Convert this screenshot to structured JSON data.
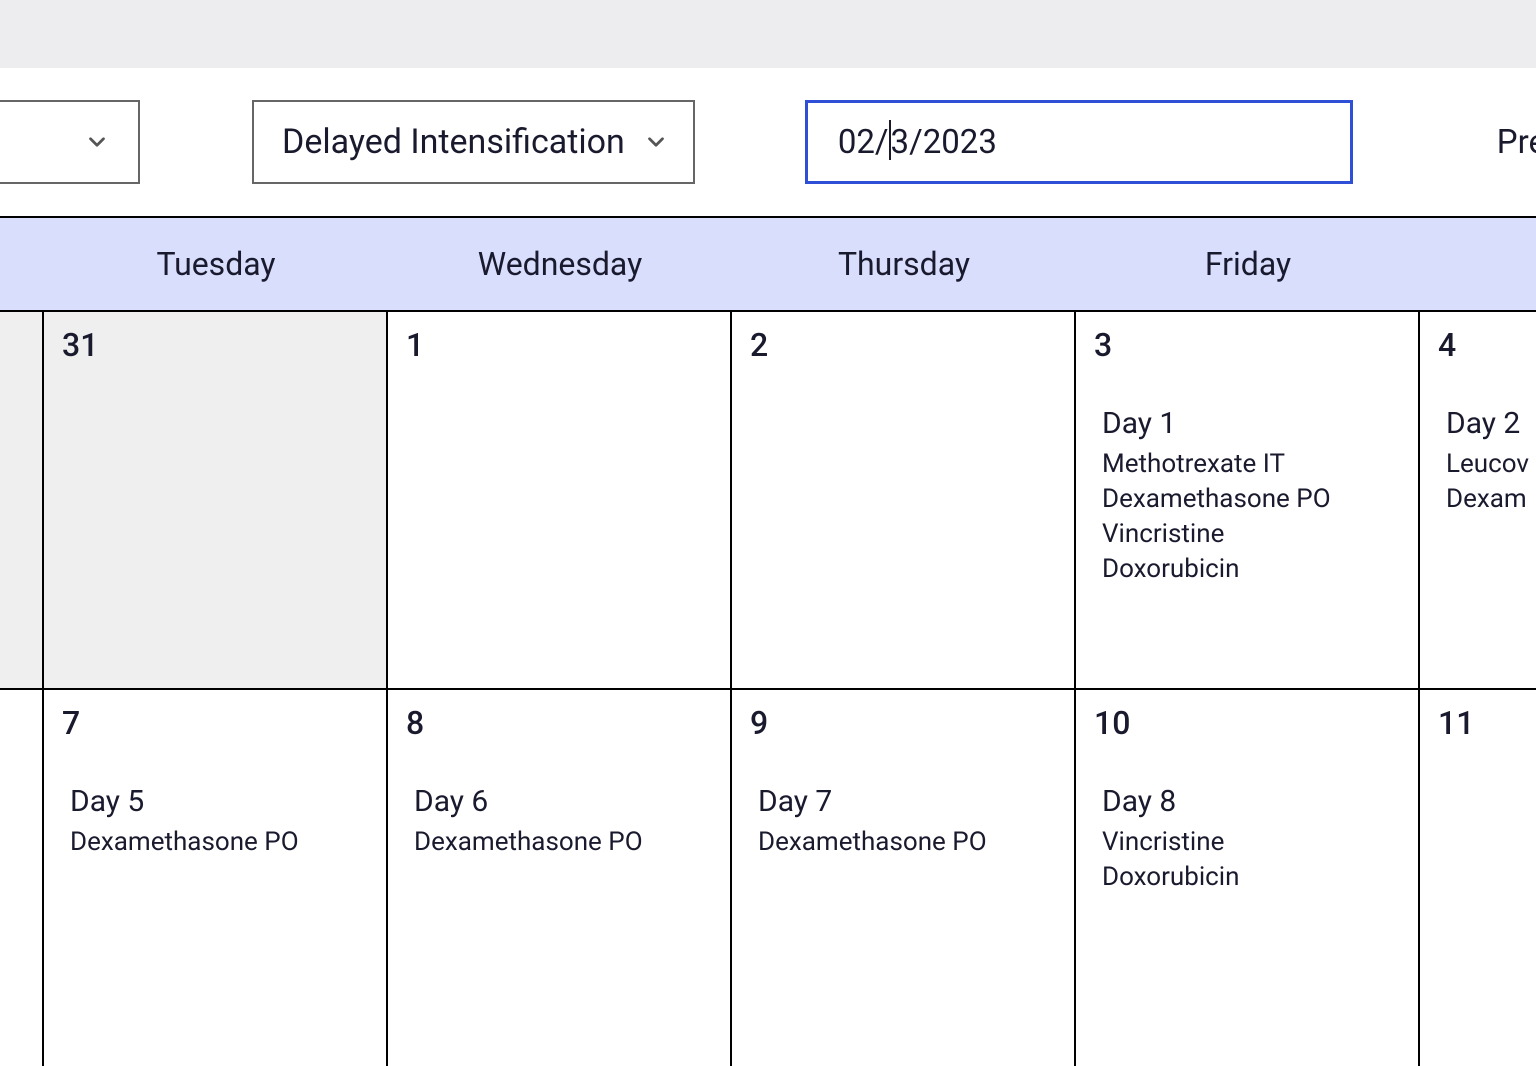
{
  "toolbar": {
    "phase_label": "Delayed Intensification",
    "date_before": "02/",
    "date_after": "3/2023",
    "right_action": "Pre"
  },
  "weekdays": [
    "Tuesday",
    "Wednesday",
    "Thursday",
    "Friday"
  ],
  "rows": [
    {
      "spacer_grey": true,
      "cells": [
        {
          "num": "31",
          "grey": true,
          "entry": null
        },
        {
          "num": "1",
          "grey": false,
          "entry": null
        },
        {
          "num": "2",
          "grey": false,
          "entry": null
        },
        {
          "num": "3",
          "grey": false,
          "entry": {
            "label": "Day 1",
            "meds": [
              "Methotrexate IT",
              "Dexamethasone PO",
              "Vincristine",
              "Doxorubicin"
            ]
          }
        },
        {
          "num": "4",
          "grey": false,
          "entry": {
            "label": "Day 2",
            "meds": [
              "Leucov",
              "Dexam"
            ]
          },
          "last": true
        }
      ]
    },
    {
      "spacer_grey": false,
      "cells": [
        {
          "num": "7",
          "grey": false,
          "entry": {
            "label": "Day 5",
            "meds": [
              "Dexamethasone PO"
            ]
          }
        },
        {
          "num": "8",
          "grey": false,
          "entry": {
            "label": "Day 6",
            "meds": [
              "Dexamethasone PO"
            ]
          }
        },
        {
          "num": "9",
          "grey": false,
          "entry": {
            "label": "Day 7",
            "meds": [
              "Dexamethasone PO"
            ]
          }
        },
        {
          "num": "10",
          "grey": false,
          "entry": {
            "label": "Day 8",
            "meds": [
              "Vincristine",
              "Doxorubicin"
            ]
          }
        },
        {
          "num": "11",
          "grey": false,
          "entry": null,
          "last": true
        }
      ]
    }
  ]
}
